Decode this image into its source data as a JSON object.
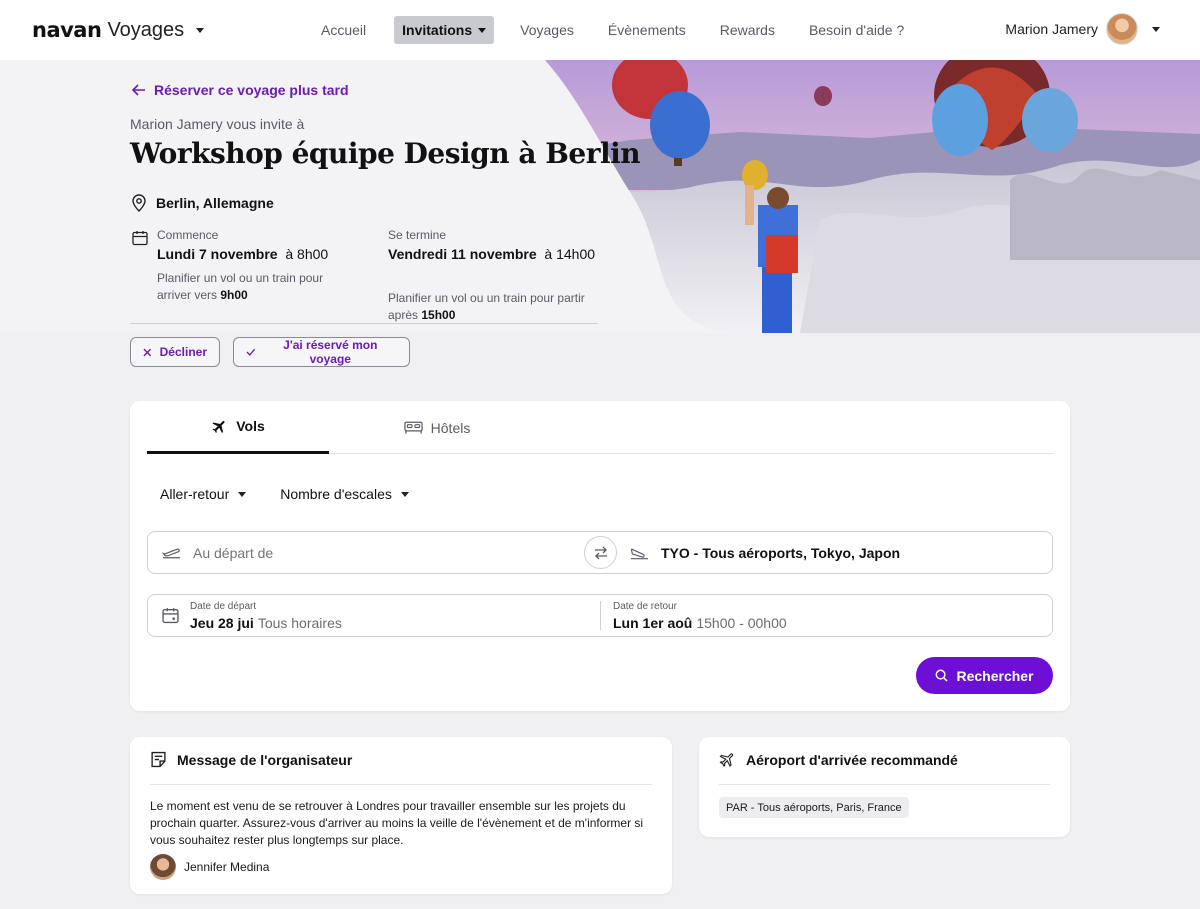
{
  "nav": {
    "brand_logo": "navan",
    "brand_product": "Voyages",
    "links": [
      {
        "label": "Accueil"
      },
      {
        "label": "Invitations"
      },
      {
        "label": "Voyages"
      },
      {
        "label": "Évènements"
      },
      {
        "label": "Rewards"
      },
      {
        "label": "Besoin d'aide ?"
      }
    ],
    "user_name": "Marion Jamery"
  },
  "hero": {
    "back_label": "Réserver ce voyage plus tard",
    "inviter": "Marion Jamery vous invite à",
    "title": "Workshop équipe Design à Berlin",
    "location": "Berlin, Allemagne",
    "start": {
      "label": "Commence",
      "day": "Lundi 7 novembre",
      "time": "à 8h00",
      "note_text": "Planifier un vol ou un train pour arriver vers",
      "note_time": "9h00"
    },
    "end": {
      "label": "Se termine",
      "day": "Vendredi 11 novembre",
      "time": "à 14h00",
      "note_text": "Planifier un vol ou un train pour partir après",
      "note_time": "15h00"
    },
    "decline_label": "Décliner",
    "booked_label": "J'ai réservé mon voyage"
  },
  "search": {
    "tabs": [
      {
        "label": "Vols",
        "icon": "airplane-icon"
      },
      {
        "label": "Hôtels",
        "icon": "bed-icon"
      }
    ],
    "trip_type": "Aller-retour",
    "stops": "Nombre d'escales",
    "origin_placeholder": "Au départ de",
    "destination": "TYO - Tous aéroports, Tokyo, Japon",
    "depart_label": "Date de départ",
    "depart_date": "Jeu 28 jui",
    "depart_time": "Tous horaires",
    "return_label": "Date de retour",
    "return_date": "Lun 1er aoû",
    "return_time": "15h00 - 00h00",
    "search_label": "Rechercher"
  },
  "message": {
    "title": "Message de l'organisateur",
    "body": "Le moment est venu de se retrouver à Londres pour travailler ensemble sur les projets du prochain quarter. Assurez-vous d'arriver au moins la veille de l'évènement et de m'informer si vous souhaitez rester plus longtemps sur place.",
    "author": "Jennifer Medina"
  },
  "airport": {
    "title": "Aéroport d'arrivée recommandé",
    "chip": "PAR - Tous aéroports, Paris, France"
  },
  "colors": {
    "accent": "#6e0fd6",
    "link": "#6c1bb3",
    "background": "#f0f0f2"
  }
}
